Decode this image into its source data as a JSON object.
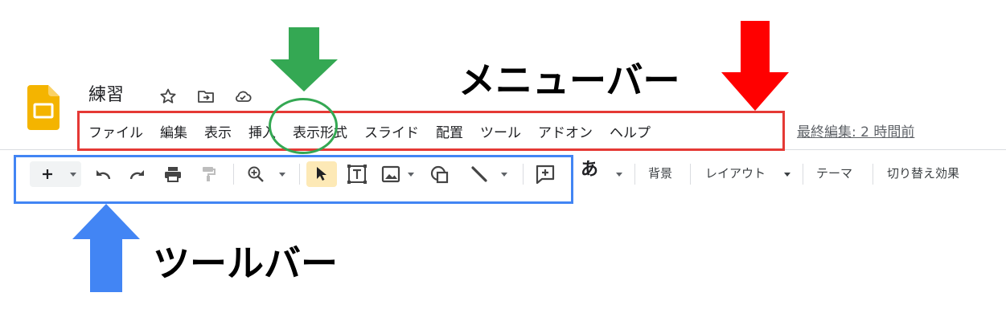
{
  "doc": {
    "title": "練習"
  },
  "menu": {
    "items": [
      "ファイル",
      "編集",
      "表示",
      "挿入",
      "表示形式",
      "スライド",
      "配置",
      "ツール",
      "アドオン",
      "ヘルプ"
    ],
    "last_edit": "最終編集: 2 時間前"
  },
  "toolbar": {
    "font_glyph": "あ",
    "background": "背景",
    "layout": "レイアウト",
    "theme": "テーマ",
    "transition": "切り替え効果"
  },
  "annotations": {
    "menubar_label": "メニューバー",
    "toolbar_label": "ツールバー"
  },
  "colors": {
    "slides_yellow": "#f4b400",
    "annotation_red": "#e53935",
    "annotation_green": "#34a853",
    "annotation_blue": "#4285f4"
  },
  "icons": [
    "star-icon",
    "move-to-folder-icon",
    "cloud-saved-icon",
    "new-slide-icon",
    "undo-icon",
    "redo-icon",
    "print-icon",
    "paint-format-icon",
    "zoom-icon",
    "select-cursor-icon",
    "text-box-icon",
    "image-icon",
    "shape-icon",
    "line-icon",
    "comment-add-icon"
  ]
}
